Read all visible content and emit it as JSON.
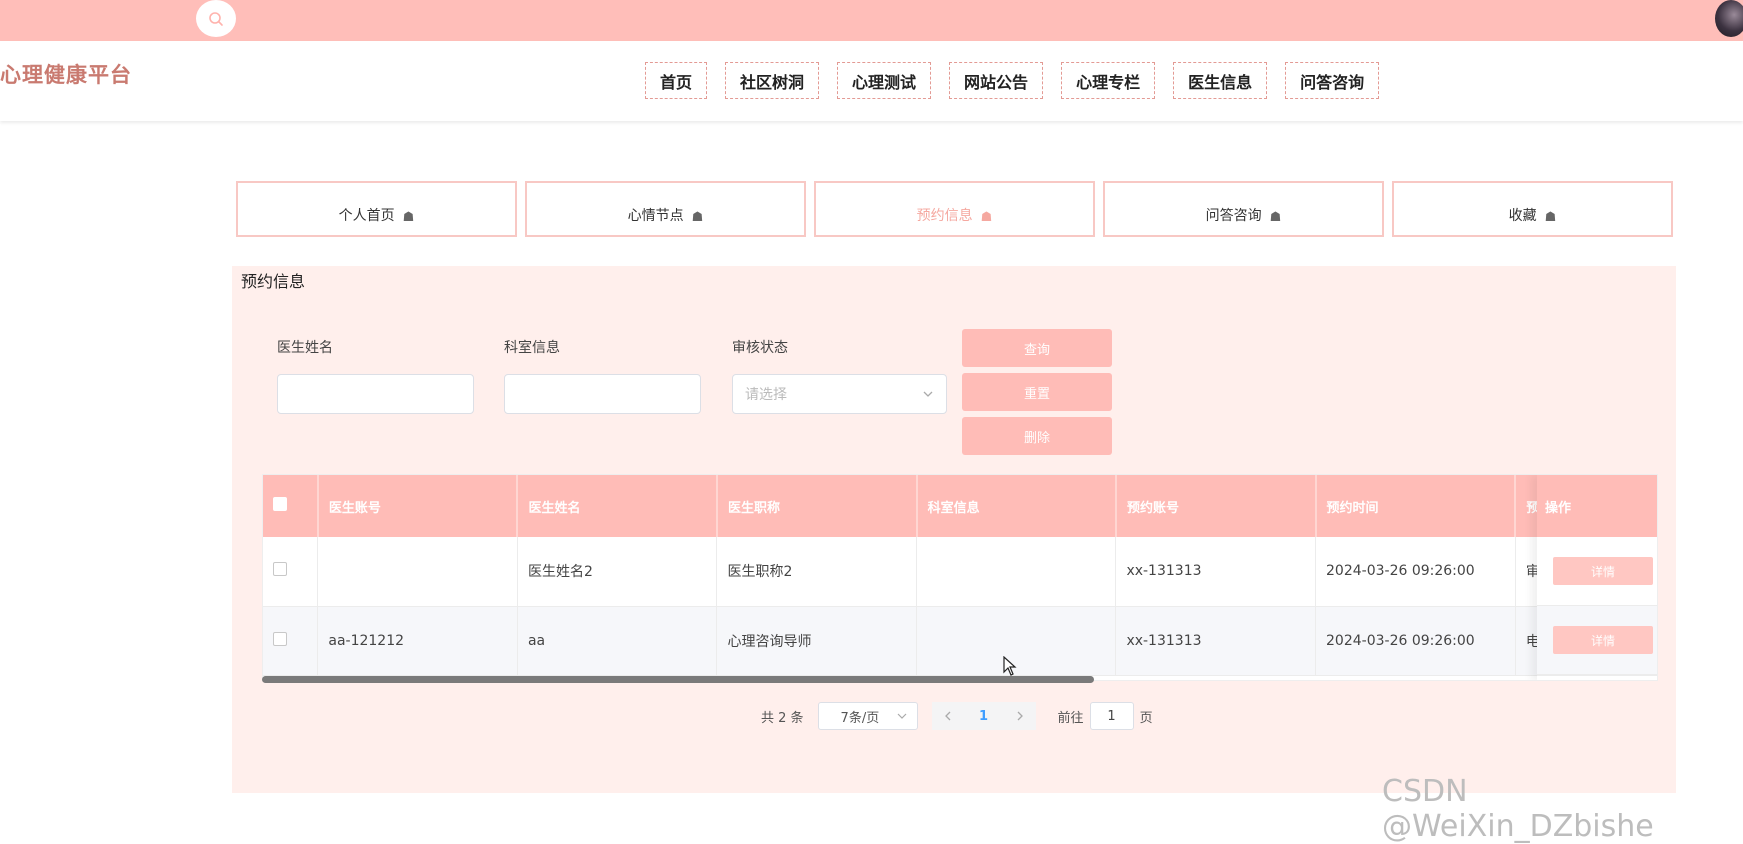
{
  "topbar": {
    "search_icon": "search-icon",
    "avatar": "avatar"
  },
  "header": {
    "brand": "心理健康平台",
    "nav": [
      "首页",
      "社区树洞",
      "心理测试",
      "网站公告",
      "心理专栏",
      "医生信息",
      "问答咨询"
    ]
  },
  "tabs": [
    {
      "label": "个人首页",
      "active": false
    },
    {
      "label": "心情节点",
      "active": false
    },
    {
      "label": "预约信息",
      "active": true
    },
    {
      "label": "问答咨询",
      "active": false
    },
    {
      "label": "收藏",
      "active": false
    }
  ],
  "panel": {
    "title": "预约信息",
    "filters": {
      "doctor_name_label": "医生姓名",
      "doctor_name_value": "",
      "dept_label": "科室信息",
      "dept_value": "",
      "status_label": "审核状态",
      "status_placeholder": "请选择"
    },
    "buttons": {
      "search": "查询",
      "reset": "重置",
      "delete": "删除"
    },
    "table": {
      "headers": [
        "医生账号",
        "医生姓名",
        "医生职称",
        "科室信息",
        "预约账号",
        "预约时间",
        "预"
      ],
      "op_header": "操作",
      "rows": [
        {
          "cells": [
            "",
            "医生姓名2",
            "医生职称2",
            "",
            "xx-131313",
            "2024-03-26 09:26:00",
            "审"
          ],
          "action": "详情"
        },
        {
          "cells": [
            "aa-121212",
            "aa",
            "心理咨询导师",
            "",
            "xx-131313",
            "2024-03-26 09:26:00",
            "电"
          ],
          "action": "详情"
        }
      ]
    },
    "pagination": {
      "total": "共 2 条",
      "page_size": "7条/页",
      "current_page": "1",
      "goto_prefix": "前往",
      "goto_value": "1",
      "goto_suffix": "页"
    }
  },
  "watermark": "CSDN @WeiXin_DZbishe",
  "colors": {
    "accent": "#ffbcb7",
    "brand": "#c97a70",
    "panel_bg": "#ffefec"
  }
}
